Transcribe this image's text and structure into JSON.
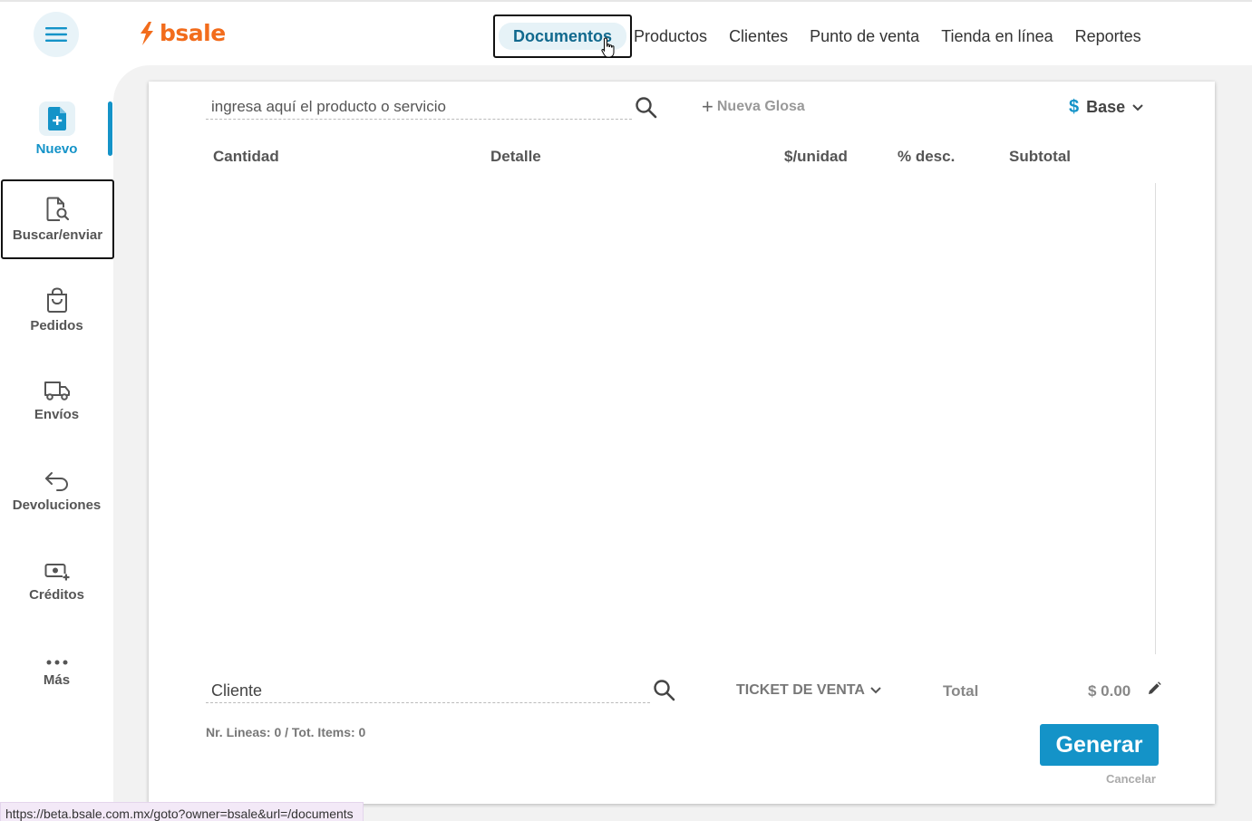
{
  "header": {
    "logo_text": "bsale",
    "nav": [
      {
        "label": "Documentos"
      },
      {
        "label": "Productos"
      },
      {
        "label": "Clientes"
      },
      {
        "label": "Punto de venta"
      },
      {
        "label": "Tienda en línea"
      },
      {
        "label": "Reportes"
      }
    ]
  },
  "sidebar": {
    "items": [
      {
        "label": "Nuevo",
        "icon": "file-plus-icon"
      },
      {
        "label": "Buscar/enviar",
        "icon": "file-search-icon"
      },
      {
        "label": "Pedidos",
        "icon": "shopping-bag-icon"
      },
      {
        "label": "Envíos",
        "icon": "truck-icon"
      },
      {
        "label": "Devoluciones",
        "icon": "return-arrow-icon"
      },
      {
        "label": "Créditos",
        "icon": "cash-plus-icon"
      },
      {
        "label": "Más",
        "icon": "more-dots-icon"
      }
    ]
  },
  "document": {
    "product_placeholder": "ingresa aquí el producto o servicio",
    "new_gloss": "Nueva Glosa",
    "price_list_symbol": "$",
    "price_list": "Base",
    "columns": [
      "Cantidad",
      "Detalle",
      "$/unidad",
      "% desc.",
      "Subtotal"
    ],
    "client_placeholder": "Cliente",
    "doc_type": "TICKET DE VENTA",
    "total_label": "Total",
    "total_value": "$ 0.00",
    "lines_info": "Nr. Lineas: 0 / Tot. Items: 0",
    "generate_label": "Generar",
    "cancel_label": "Cancelar"
  },
  "status_bar": {
    "url": "https://beta.bsale.com.mx/goto?owner=bsale&url=/documents"
  },
  "colors": {
    "brand_orange": "#f26c1c",
    "accent_blue": "#1493c8"
  }
}
